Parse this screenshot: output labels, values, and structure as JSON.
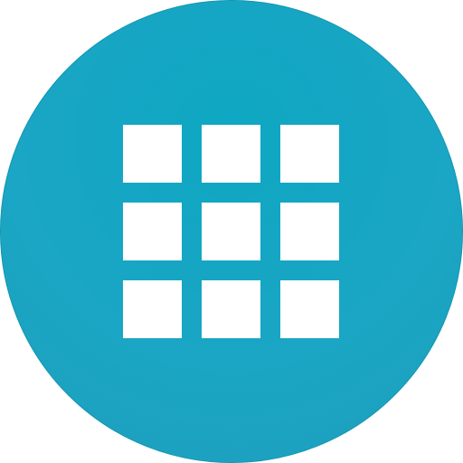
{
  "icon": {
    "name": "apps-grid-icon",
    "colors": {
      "circle_top": "#0ea7c3",
      "circle_mid": "#1aa6c4",
      "circle_bottom": "#1e9fbd",
      "rim": "#1296b2",
      "tile": "#ffffff"
    },
    "grid": {
      "rows": 3,
      "columns": 3
    }
  }
}
